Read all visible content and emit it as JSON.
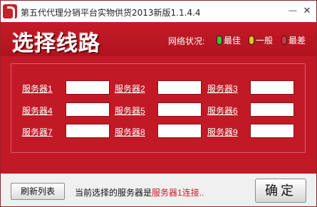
{
  "window": {
    "title": "第五代代理分销平台实物供货2013新版1.1.4.4",
    "minimize_glyph": "—",
    "close_glyph": "✕"
  },
  "banner": {
    "heading": "选择线路",
    "status_label": "网络状况:",
    "legend": [
      {
        "label": "最佳",
        "color": "#3cc43c"
      },
      {
        "label": "一般",
        "color": "#f0c020"
      },
      {
        "label": "最差",
        "color": "#e03040"
      }
    ]
  },
  "servers": [
    {
      "label": "服务器1",
      "value": ""
    },
    {
      "label": "服务器2",
      "value": ""
    },
    {
      "label": "服务器3",
      "value": ""
    },
    {
      "label": "服务器4",
      "value": ""
    },
    {
      "label": "服务器5",
      "value": ""
    },
    {
      "label": "服务器6",
      "value": ""
    },
    {
      "label": "服务器7",
      "value": ""
    },
    {
      "label": "服务器8",
      "value": ""
    },
    {
      "label": "服务器9",
      "value": ""
    }
  ],
  "footer": {
    "refresh_label": "刷新列表",
    "status_prefix": "当前选择的服务器是",
    "status_highlight": "服务器1连接..",
    "ok_label": "确定"
  },
  "colors": {
    "brand_red": "#c11a26",
    "title_text": "#222222"
  }
}
